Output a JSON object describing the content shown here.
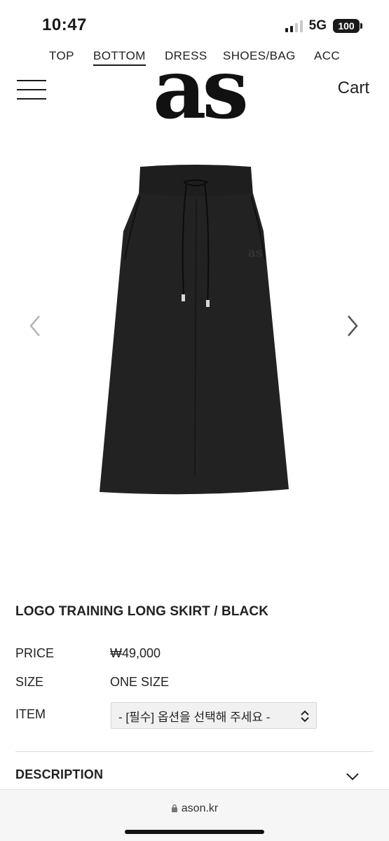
{
  "status": {
    "time": "10:47",
    "network": "5G",
    "battery": "100"
  },
  "categories": [
    {
      "label": "TOP",
      "active": false
    },
    {
      "label": "BOTTOM",
      "active": true
    },
    {
      "label": "DRESS",
      "active": false
    },
    {
      "label": "SHOES/BAG",
      "active": false
    },
    {
      "label": "ACC",
      "active": false
    }
  ],
  "header": {
    "logo": "as",
    "cart_label": "Cart"
  },
  "product": {
    "image_icon": "black-long-skirt-image",
    "title": "LOGO TRAINING LONG SKIRT / BLACK",
    "price_label": "PRICE",
    "price_value": "₩49,000",
    "size_label": "SIZE",
    "size_value": "ONE SIZE",
    "item_label": "ITEM",
    "item_select_value": "- [필수] 옵션을 선택해 주세요 -"
  },
  "description": {
    "label": "DESCRIPTION"
  },
  "browser": {
    "url": "ason.kr"
  }
}
